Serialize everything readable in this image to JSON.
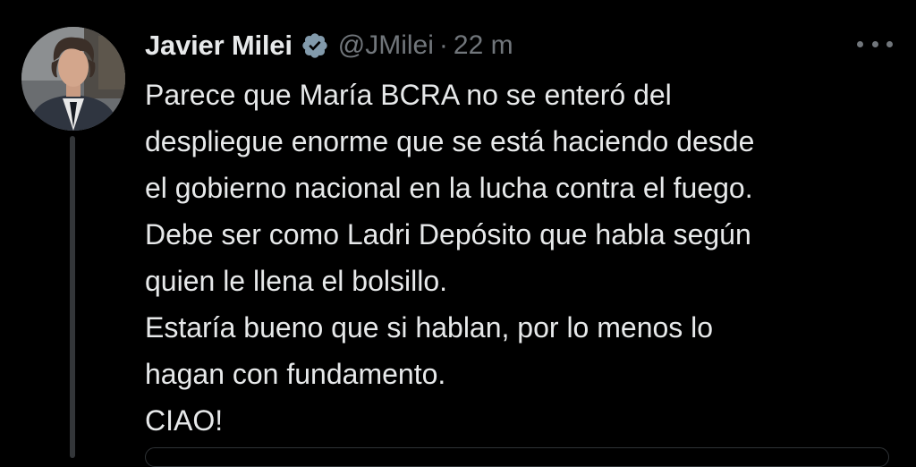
{
  "author": {
    "name": "Javier Milei",
    "handle": "@JMilei",
    "separator": "·",
    "timestamp": "22 m"
  },
  "icons": {
    "verified": "verified-badge-icon",
    "more": "more-options-icon"
  },
  "tweet": {
    "lines": [
      "Parece que María BCRA no se enteró del",
      "despliegue enorme que se está haciendo desde",
      "el gobierno nacional en la lucha contra el fuego.",
      "Debe ser como Ladri Depósito que habla según",
      "quien le llena el bolsillo.",
      "Estaría bueno que si hablan, por lo menos lo",
      "hagan con fundamento.",
      "CIAO!"
    ]
  },
  "colors": {
    "background": "#000000",
    "text_primary": "#e7e9ea",
    "text_secondary": "#71767b",
    "thread_line": "#333639",
    "verified_badge": "#829aab"
  }
}
